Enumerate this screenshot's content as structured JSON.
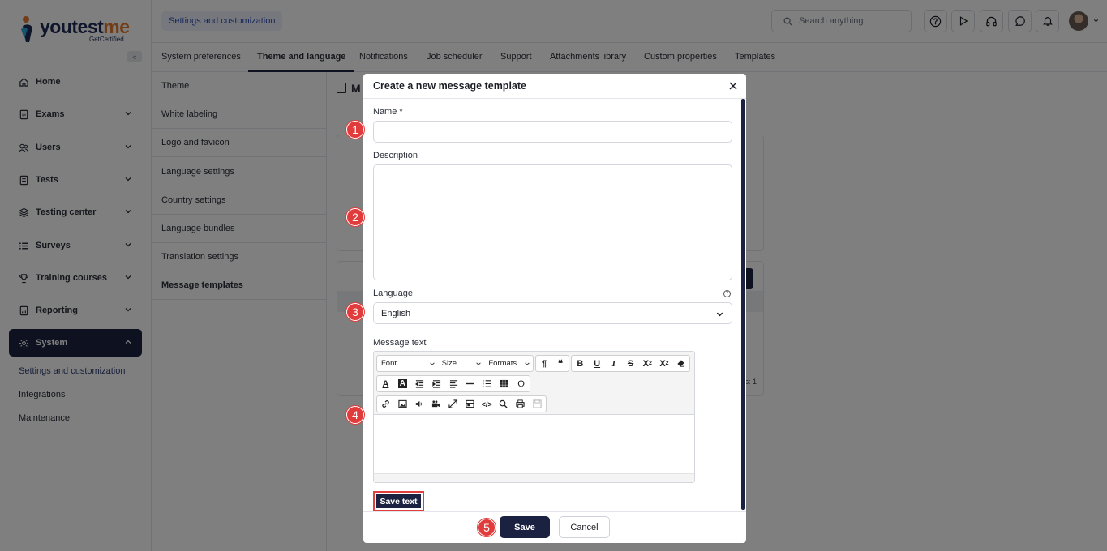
{
  "brand": {
    "name_prefix": "youtest",
    "name_suffix": "me",
    "tagline": "GetCertified"
  },
  "sidebar": {
    "items": [
      {
        "label": "Home",
        "icon": "home-icon"
      },
      {
        "label": "Exams",
        "icon": "document-icon"
      },
      {
        "label": "Users",
        "icon": "users-icon"
      },
      {
        "label": "Tests",
        "icon": "test-icon"
      },
      {
        "label": "Testing center",
        "icon": "testing-center-icon"
      },
      {
        "label": "Surveys",
        "icon": "list-icon"
      },
      {
        "label": "Training courses",
        "icon": "trophy-icon"
      },
      {
        "label": "Reporting",
        "icon": "report-icon"
      },
      {
        "label": "System",
        "icon": "gear-icon"
      }
    ],
    "sub_items": [
      "Settings and customization",
      "Integrations",
      "Maintenance"
    ]
  },
  "header": {
    "breadcrumb": "Settings and customization",
    "search_placeholder": "Search anything"
  },
  "tabs": [
    "System preferences",
    "Theme and language",
    "Notifications",
    "Job scheduler",
    "Support",
    "Attachments library",
    "Custom properties",
    "Templates"
  ],
  "settings_list": [
    "Theme",
    "White labeling",
    "Logo and favicon",
    "Language settings",
    "Country settings",
    "Language bundles",
    "Translation settings",
    "Message templates"
  ],
  "background": {
    "title_fragment": "M",
    "results_fragment": "s: 1"
  },
  "modal": {
    "title": "Create a new message template",
    "name_label": "Name *",
    "description_label": "Description",
    "language_label": "Language",
    "language_value": "English",
    "message_text_label": "Message text",
    "editor": {
      "font": "Font",
      "size": "Size",
      "formats": "Formats"
    },
    "save_text_label": "Save text",
    "save_label": "Save",
    "cancel_label": "Cancel"
  },
  "annotations": [
    "1",
    "2",
    "3",
    "4",
    "5"
  ]
}
